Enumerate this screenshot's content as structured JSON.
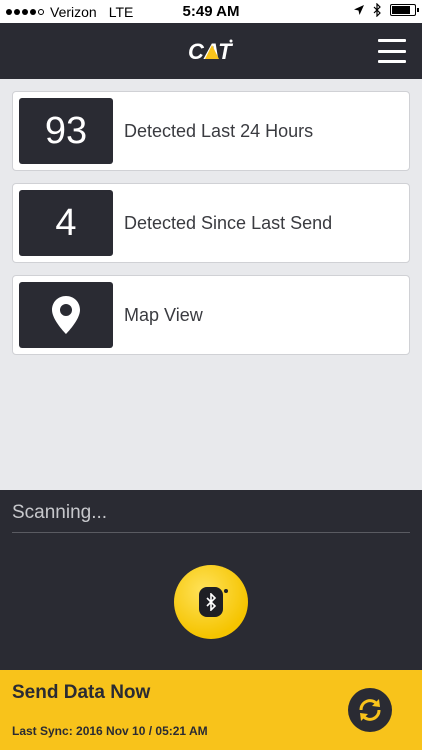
{
  "status_bar": {
    "carrier": "Verizon",
    "network": "LTE",
    "time": "5:49 AM",
    "signal_bars_filled": 4,
    "signal_bars_total": 5,
    "battery_level": 0.8
  },
  "header": {
    "logo_text": "CAT",
    "menu_icon": "hamburger-icon"
  },
  "cards": [
    {
      "value": "93",
      "label": "Detected Last 24 Hours"
    },
    {
      "value": "4",
      "label": "Detected Since Last Send"
    },
    {
      "icon": "map-pin-icon",
      "label": "Map View"
    }
  ],
  "scan": {
    "status": "Scanning...",
    "button_icon": "bluetooth-icon"
  },
  "send": {
    "title": "Send Data Now",
    "last_sync": "Last Sync: 2016 Nov 10 / 05:21 AM",
    "sync_icon": "sync-icon"
  },
  "colors": {
    "dark": "#2a2b33",
    "accent_yellow": "#f8c31b",
    "background": "#e8e9ec"
  }
}
